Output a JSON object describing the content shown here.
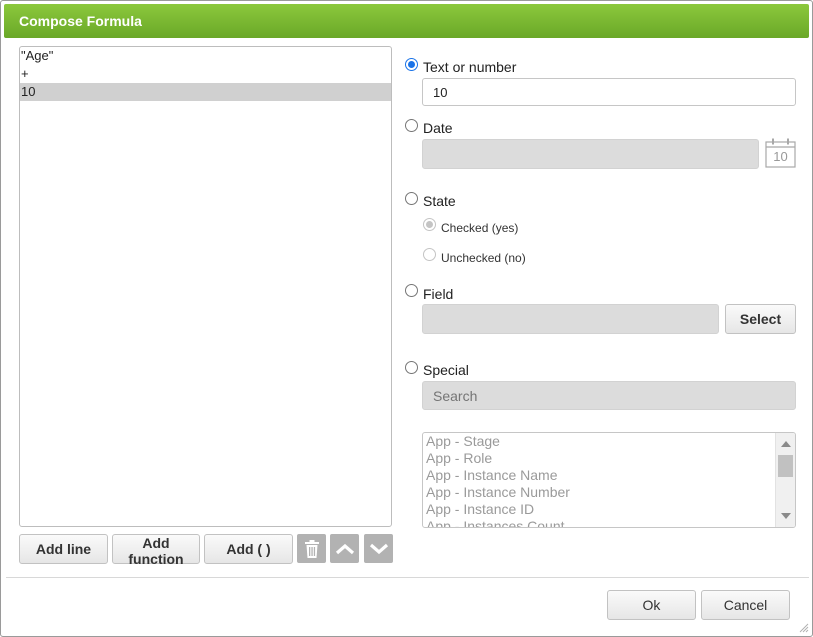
{
  "dialog": {
    "title": "Compose Formula"
  },
  "formula": {
    "lines": [
      {
        "text": "\"Age\"",
        "selected": false
      },
      {
        "text": "+",
        "selected": false
      },
      {
        "text": "10",
        "selected": true
      }
    ]
  },
  "toolbar": {
    "add_line": "Add line",
    "add_function": "Add function",
    "add_parens": "Add ( )",
    "delete_icon": "trash-icon",
    "move_up_icon": "chevron-up-icon",
    "move_down_icon": "chevron-down-icon"
  },
  "options": {
    "text_or_number": {
      "label": "Text or number",
      "value": "10",
      "checked": true
    },
    "date": {
      "label": "Date",
      "value": "",
      "calendar_day": "10"
    },
    "state": {
      "label": "State",
      "checked_label": "Checked (yes)",
      "unchecked_label": "Unchecked (no)",
      "selected": "checked"
    },
    "field": {
      "label": "Field",
      "value": "",
      "select_label": "Select"
    },
    "special": {
      "label": "Special",
      "search_placeholder": "Search",
      "items": [
        "App - Stage",
        "App - Role",
        "App - Instance Name",
        "App - Instance Number",
        "App - Instance ID",
        "App - Instances Count"
      ]
    }
  },
  "footer": {
    "ok": "Ok",
    "cancel": "Cancel"
  },
  "colors": {
    "title_bar": "#7ab832",
    "radio_accent": "#1a73e8",
    "icon_button": "#b2b2b2"
  }
}
